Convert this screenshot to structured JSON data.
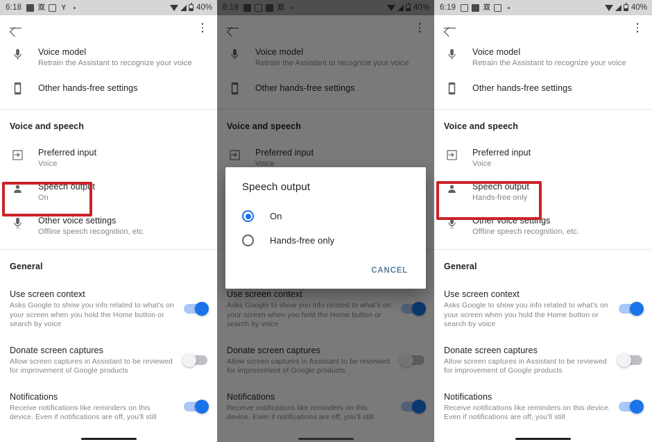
{
  "meta": {
    "accent_blue": "#1a73e8",
    "toggle_track_on": "#a9c7f8",
    "toggle_track_off": "#bdc1c6",
    "highlight_red": "#cc2127",
    "dialog_button_color": "#5b7f9e",
    "text_primary": "#202124",
    "text_secondary": "#80868b"
  },
  "panels": [
    {
      "id": "panel-1",
      "status": {
        "time": "6:18",
        "battery_percent": "40%",
        "icons": [
          "photo-icon",
          "running-icon",
          "camera-icon",
          "y-icon",
          "dot-icon"
        ]
      },
      "appbar": {
        "back": "back-arrow-icon",
        "menu": "overflow-menu-icon"
      },
      "rows_top": [
        {
          "icon": "microphone-icon",
          "title": "Voice model",
          "sub": "Retrain the Assistant to recognize your voice"
        },
        {
          "icon": "phone-icon",
          "title": "Other hands-free settings",
          "sub": ""
        }
      ],
      "section_voice": "Voice and speech",
      "rows_voice": [
        {
          "icon": "input-arrow-icon",
          "title": "Preferred input",
          "sub": "Voice"
        },
        {
          "icon": "person-icon",
          "title": "Speech output",
          "sub": "On",
          "highlighted": true
        },
        {
          "icon": "microphone-icon",
          "title": "Other voice settings",
          "sub": "Offline speech recognition, etc."
        }
      ],
      "section_general": "General",
      "rows_general": [
        {
          "title": "Use screen context",
          "sub": "Asks Google to show you info related to what's on your screen when you hold the Home button or search by voice",
          "toggle": "on"
        },
        {
          "title": "Donate screen captures",
          "sub": "Allow screen captures in Assistant to be reviewed for improvement of Google products",
          "toggle": "off"
        },
        {
          "title": "Notifications",
          "sub": "Receive notifications like reminders on this device. Even if notifications are off, you'll still",
          "toggle": "on"
        }
      ],
      "dialog": null,
      "dimmed": false
    },
    {
      "id": "panel-2",
      "status": {
        "time": "6:18",
        "battery_percent": "40%",
        "icons": [
          "mail-icon",
          "photo-icon",
          "photo-icon",
          "running-icon",
          "dot-icon"
        ]
      },
      "appbar": {
        "back": "back-arrow-icon",
        "menu": "overflow-menu-icon"
      },
      "rows_top": [
        {
          "icon": "microphone-icon",
          "title": "Voice model",
          "sub": "Retrain the Assistant to recognize your voice"
        },
        {
          "icon": "phone-icon",
          "title": "Other hands-free settings",
          "sub": ""
        }
      ],
      "section_voice": "Voice and speech",
      "rows_voice": [
        {
          "icon": "input-arrow-icon",
          "title": "Preferred input",
          "sub": "Voice"
        },
        {
          "icon": "person-icon",
          "title": "Speech output",
          "sub": "On",
          "highlighted": false
        },
        {
          "icon": "microphone-icon",
          "title": "Other voice settings",
          "sub": "Offline speech recognition, etc."
        }
      ],
      "section_general": "General",
      "rows_general": [
        {
          "title": "Use screen context",
          "sub": "Asks Google to show you info related to what's on your screen when you hold the Home button or search by voice",
          "toggle": "on"
        },
        {
          "title": "Donate screen captures",
          "sub": "Allow screen captures in Assistant to be reviewed for improvement of Google products",
          "toggle": "off"
        },
        {
          "title": "Notifications",
          "sub": "Receive notifications like reminders on this device. Even if notifications are off, you'll still",
          "toggle": "on"
        }
      ],
      "dialog": {
        "title": "Speech output",
        "options": [
          {
            "label": "On",
            "selected": true
          },
          {
            "label": "Hands-free only",
            "selected": false
          }
        ],
        "cancel_label": "CANCEL"
      },
      "dimmed": true
    },
    {
      "id": "panel-3",
      "status": {
        "time": "6:19",
        "battery_percent": "40%",
        "icons": [
          "photo-icon",
          "photo-icon",
          "running-icon",
          "camera-icon",
          "dot-icon"
        ]
      },
      "appbar": {
        "back": "back-arrow-icon",
        "menu": "overflow-menu-icon"
      },
      "rows_top": [
        {
          "icon": "microphone-icon",
          "title": "Voice model",
          "sub": "Retrain the Assistant to recognize your voice"
        },
        {
          "icon": "phone-icon",
          "title": "Other hands-free settings",
          "sub": ""
        }
      ],
      "section_voice": "Voice and speech",
      "rows_voice": [
        {
          "icon": "input-arrow-icon",
          "title": "Preferred input",
          "sub": "Voice"
        },
        {
          "icon": "person-icon",
          "title": "Speech output",
          "sub": "Hands-free only",
          "highlighted": true
        },
        {
          "icon": "microphone-icon",
          "title": "Other voice settings",
          "sub": "Offline speech recognition, etc."
        }
      ],
      "section_general": "General",
      "rows_general": [
        {
          "title": "Use screen context",
          "sub": "Asks Google to show you info related to what's on your screen when you hold the Home button or search by voice",
          "toggle": "on"
        },
        {
          "title": "Donate screen captures",
          "sub": "Allow screen captures in Assistant to be reviewed for improvement of Google products",
          "toggle": "off"
        },
        {
          "title": "Notifications",
          "sub": "Receive notifications like reminders on this device. Even if notifications are off, you'll still",
          "toggle": "on"
        }
      ],
      "dialog": null,
      "dimmed": false
    }
  ]
}
